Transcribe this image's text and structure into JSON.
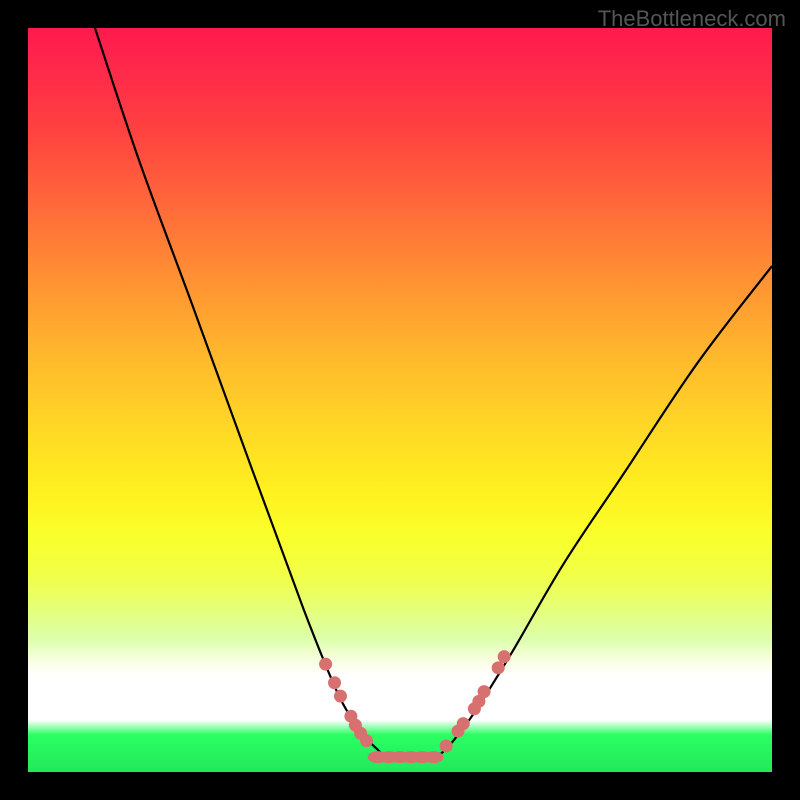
{
  "watermark": "TheBottleneck.com",
  "chart_data": {
    "type": "line",
    "title": "",
    "xlabel": "",
    "ylabel": "",
    "xlim": [
      0,
      100
    ],
    "ylim": [
      0,
      100
    ],
    "series": [
      {
        "name": "left-curve",
        "x": [
          9,
          15,
          22,
          30,
          37,
          41,
          43,
          45,
          47,
          48
        ],
        "y": [
          100,
          82,
          63,
          41,
          22,
          12,
          8,
          5,
          3,
          2
        ]
      },
      {
        "name": "floor",
        "x": [
          48,
          55
        ],
        "y": [
          2,
          2
        ]
      },
      {
        "name": "right-curve",
        "x": [
          55,
          57,
          60,
          65,
          72,
          80,
          90,
          100
        ],
        "y": [
          2,
          4,
          8,
          16,
          28,
          40,
          55,
          68
        ]
      }
    ],
    "points_left": [
      {
        "x": 40.0,
        "y": 14.5
      },
      {
        "x": 41.2,
        "y": 12.0
      },
      {
        "x": 42.0,
        "y": 10.2
      },
      {
        "x": 43.4,
        "y": 7.5
      },
      {
        "x": 44.0,
        "y": 6.3
      },
      {
        "x": 44.7,
        "y": 5.2
      },
      {
        "x": 45.5,
        "y": 4.2
      }
    ],
    "points_floor": [
      {
        "x": 47.0,
        "y": 2.0
      },
      {
        "x": 48.5,
        "y": 2.0
      },
      {
        "x": 50.0,
        "y": 2.0
      },
      {
        "x": 51.5,
        "y": 2.0
      },
      {
        "x": 53.0,
        "y": 2.0
      },
      {
        "x": 54.5,
        "y": 2.0
      }
    ],
    "points_right": [
      {
        "x": 56.2,
        "y": 3.5
      },
      {
        "x": 57.8,
        "y": 5.5
      },
      {
        "x": 58.5,
        "y": 6.5
      },
      {
        "x": 60.0,
        "y": 8.5
      },
      {
        "x": 60.6,
        "y": 9.5
      },
      {
        "x": 61.3,
        "y": 10.8
      },
      {
        "x": 63.2,
        "y": 14.0
      },
      {
        "x": 64.0,
        "y": 15.5
      }
    ],
    "dot_radius": 6.5,
    "floor_dot_rx": 10,
    "floor_dot_ry": 6
  }
}
